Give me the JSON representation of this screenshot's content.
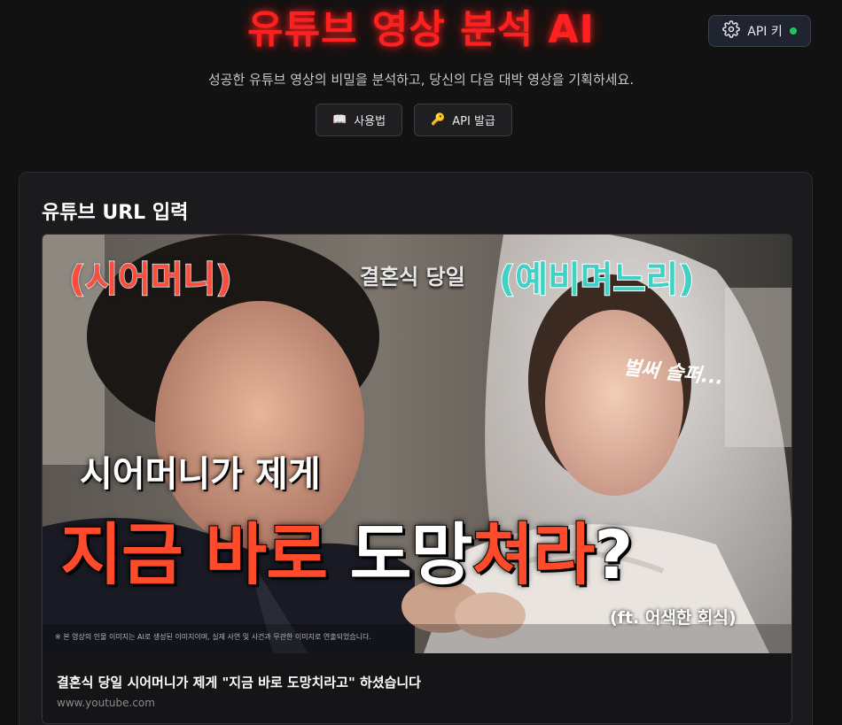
{
  "header": {
    "title": "유튜브 영상 분석 AI",
    "subtitle": "성공한 유튜브 영상의 비밀을 분석하고, 당신의 다음 대박 영상을 기획하세요.",
    "api_key_button": {
      "label": "API 키",
      "icon": "gear-icon",
      "status_color": "#22c55e"
    },
    "nav": [
      {
        "label": "사용법",
        "icon": "book-icon"
      },
      {
        "label": "API 발급",
        "icon": "key-icon"
      }
    ]
  },
  "url_section": {
    "title": "유튜브 URL 입력",
    "preview": {
      "thumbnail_text": {
        "mother_label": "(시어머니)",
        "wedding_day": "결혼식 당일",
        "bride_label": "(예비며느리)",
        "handwritten": "벌써 슬퍼...",
        "headline_line1": "시어머니가 제게",
        "headline_part_red1": "지금 바로 ",
        "headline_part_white": "도망",
        "headline_part_red2": "쳐라",
        "headline_part_end": "?",
        "footnote": "(ft. 어색한 회식)",
        "disclaimer": "※ 본 영상의 인물 이미지는 AI로 생성된 이미지이며, 실제 사연 및 사건과 무관한 이미지로 연출되었습니다."
      },
      "video_title": "결혼식 당일 시어머니가 제게 \"지금 바로 도망치라고\" 하셨습니다",
      "domain": "www.youtube.com"
    }
  },
  "colors": {
    "title": "#ff2020",
    "background": "#121212",
    "card": "#1b1b1d",
    "accent_red": "#ff4a2c",
    "accent_teal": "#3fd2c4"
  }
}
